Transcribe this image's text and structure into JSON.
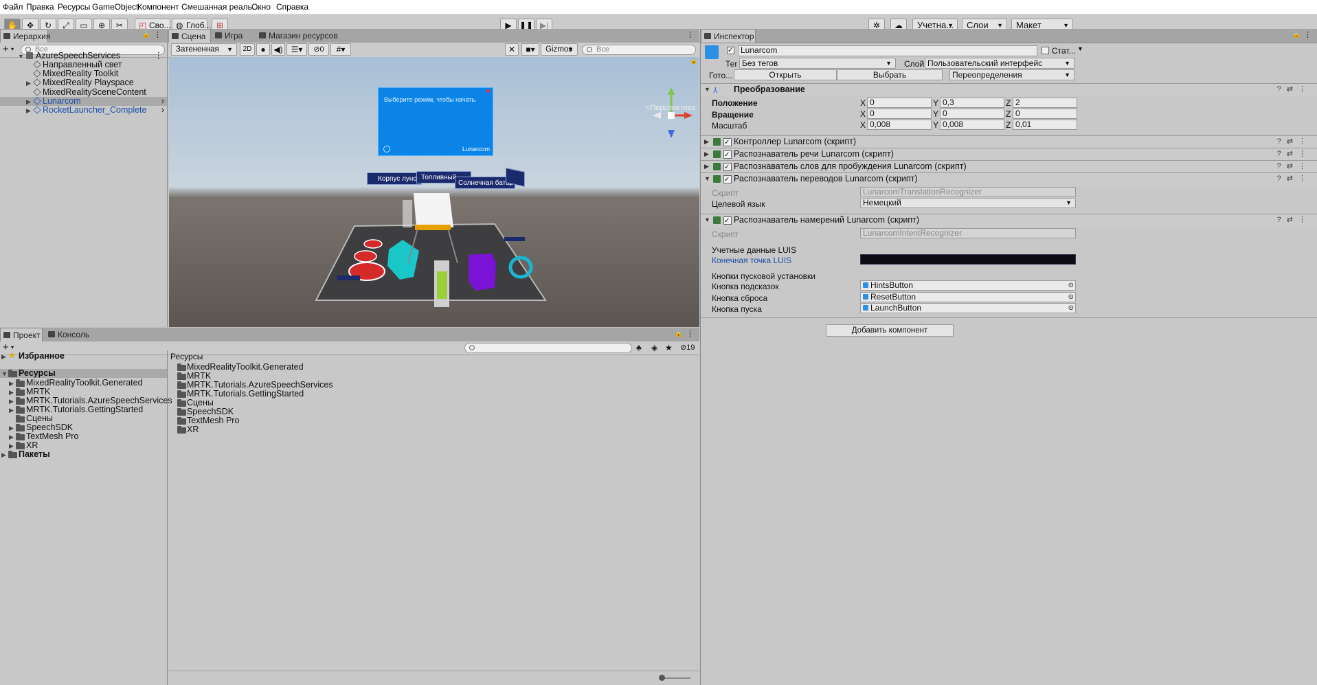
{
  "menu": [
    "Файл",
    "Правка",
    "Ресурсы",
    "GameObject",
    "Компонент",
    "Смешанная реаль...",
    "Окно",
    "Справка"
  ],
  "toolbar": {
    "pivot_label": "Сво...",
    "global_label": "Глоб...",
    "account_label": "Учетна...",
    "layers_label": "Слои",
    "layout_label": "Макет"
  },
  "hierarchy": {
    "tab": "Иерархия",
    "search_placeholder": "Все",
    "scene_name": "AzureSpeechServices",
    "items": [
      {
        "label": "Направленный свет",
        "expandable": false,
        "selected": false,
        "prefab": false
      },
      {
        "label": "MixedReality Toolkit",
        "expandable": false,
        "selected": false,
        "prefab": false
      },
      {
        "label": "MixedReality Playspace",
        "expandable": true,
        "selected": false,
        "prefab": false
      },
      {
        "label": "MixedRealitySceneContent",
        "expandable": false,
        "selected": false,
        "prefab": false
      },
      {
        "label": "Lunarcom",
        "expandable": true,
        "selected": true,
        "prefab": true
      },
      {
        "label": "RocketLauncher_Complete",
        "expandable": true,
        "selected": false,
        "prefab": true
      }
    ]
  },
  "scene": {
    "tabs": [
      "Сцена",
      "Игра",
      "Магазин ресурсов"
    ],
    "shading": "Затененная",
    "mode_2d": "2D",
    "hidden_count": "0",
    "gizmos": "Gizmos",
    "search_placeholder": "Все",
    "perspective": "Перспектива",
    "panel_text": "Выберите режим, чтобы начать.",
    "panel_brand": "Lunarcom",
    "label_hull": "Корпус луно",
    "label_fuel": "Топливный",
    "label_solar": "Солнечная батарея"
  },
  "inspector": {
    "tab": "Инспектор",
    "object_name": "Lunarcom",
    "static_label": "Стат...",
    "tag_label": "Тег",
    "tag_value": "Без тегов",
    "layer_label": "Слой",
    "layer_value": "Пользовательский интерфейс",
    "prefab_label": "Гото...",
    "open_label": "Открыть",
    "select_label": "Выбрать",
    "overrides_label": "Переопределения",
    "transform": {
      "title": "Преобразование",
      "position_label": "Положение",
      "rotation_label": "Вращение",
      "scale_label": "Масштаб",
      "position": {
        "x": "0",
        "y": "0,3",
        "z": "2"
      },
      "rotation": {
        "x": "0",
        "y": "0",
        "z": "0"
      },
      "scale": {
        "x": "0,008",
        "y": "0,008",
        "z": "0,01"
      }
    },
    "components": {
      "controller": "Контроллер Lunarcom (скрипт)",
      "speech": "Распознаватель речи Lunarcom (скрипт)",
      "wakeword": "Распознаватель слов для пробуждения Lunarcom (скрипт)",
      "translation": "Распознаватель переводов Lunarcom (скрипт)",
      "intent": "Распознаватель намерений Lunarcom (скрипт)"
    },
    "script_label": "Скрипт",
    "translation_script": "LunarcomTranslationRecognizer",
    "target_language_label": "Целевой язык",
    "target_language_value": "Немецкий",
    "intent_script": "LunarcomIntentRecognizer",
    "luis_header": "Учетные данные LUIS",
    "luis_endpoint_label": "Конечная точка LUIS",
    "launch_buttons_header": "Кнопки пусковой установки",
    "hints_button_label": "Кнопка подсказок",
    "hints_button_value": "HintsButton",
    "reset_button_label": "Кнопка сброса",
    "reset_button_value": "ResetButton",
    "launch_button_label": "Кнопка пуска",
    "launch_button_value": "LaunchButton",
    "add_component": "Добавить компонент"
  },
  "project": {
    "tabs": [
      "Проект",
      "Консоль"
    ],
    "hidden_count": "19",
    "favorites": "Избранное",
    "assets": "Ресурсы",
    "packages": "Пакеты",
    "tree": [
      "MixedRealityToolkit.Generated",
      "MRTK",
      "MRTK.Tutorials.AzureSpeechServices",
      "MRTK.Tutorials.GettingStarted",
      "Сцены",
      "SpeechSDK",
      "TextMesh Pro",
      "XR"
    ],
    "breadcrumb": "Ресурсы",
    "files": [
      "MixedRealityToolkit.Generated",
      "MRTK",
      "MRTK.Tutorials.AzureSpeechServices",
      "MRTK.Tutorials.GettingStarted",
      "Сцены",
      "SpeechSDK",
      "TextMesh Pro",
      "XR"
    ]
  },
  "colors": {
    "accent_panel": "#0a84e6",
    "scene_sky": "#a9c2db",
    "scene_ground": "#5f5a57",
    "selection": "#a9a9a9"
  }
}
